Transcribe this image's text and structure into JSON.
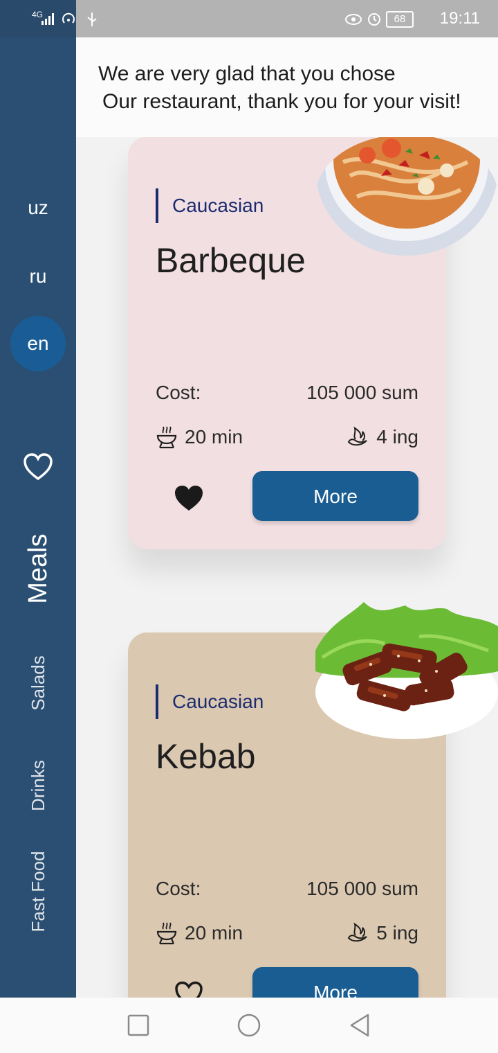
{
  "status_bar": {
    "network": "4G",
    "battery": "68",
    "time": "19:11"
  },
  "sidebar": {
    "languages": [
      "uz",
      "ru",
      "en"
    ],
    "active_language": "en",
    "categories": [
      "Meals",
      "Salads",
      "Drinks",
      "Fast Food"
    ],
    "active_category": "Meals"
  },
  "header": {
    "line1": "We are very glad that you chose",
    "line2": "Our restaurant, thank you for your visit!"
  },
  "cards": [
    {
      "category": "Caucasian",
      "name": "Barbeque",
      "cost_label": "Cost:",
      "cost_value": "105 000 sum",
      "time": "20 min",
      "ingredients": "4 ing",
      "favorited": true,
      "button_label": "More",
      "background": "#f2dfe2"
    },
    {
      "category": "Caucasian",
      "name": "Kebab",
      "cost_label": "Cost:",
      "cost_value": "105 000 sum",
      "time": "20 min",
      "ingredients": "5 ing",
      "favorited": false,
      "button_label": "More",
      "background": "#dbc8b1"
    }
  ],
  "colors": {
    "sidebar": "#2a4f72",
    "accent": "#1a5d92",
    "active_lang": "#1a5d96"
  }
}
